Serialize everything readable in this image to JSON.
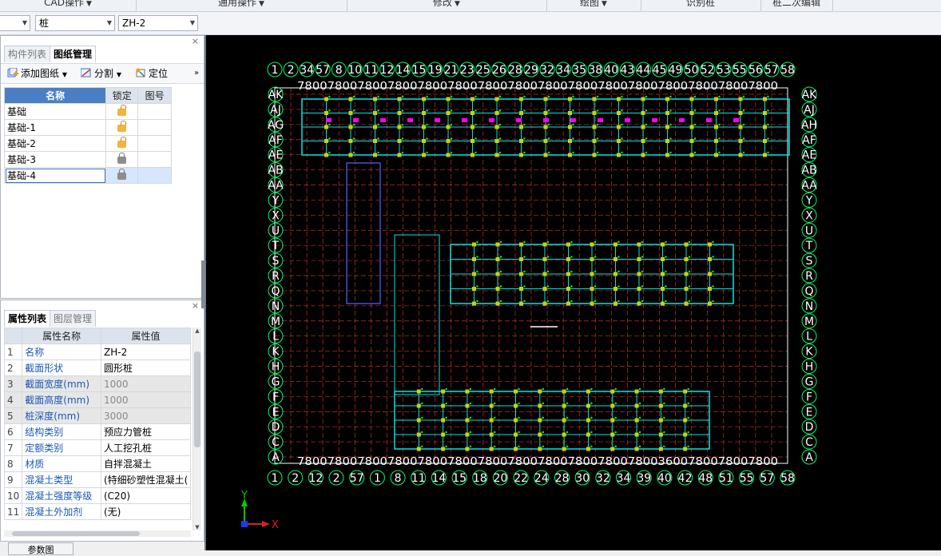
{
  "ribbon": {
    "groups": [
      {
        "label": "CAD操作",
        "arrow": true
      },
      {
        "label": "通用操作",
        "arrow": true
      },
      {
        "label": "修改",
        "arrow": true
      },
      {
        "label": "绘图",
        "arrow": true
      },
      {
        "label": "识别桩",
        "arrow": false
      },
      {
        "label": "桩二次编辑",
        "arrow": false
      }
    ]
  },
  "toolbar": {
    "combo_layer": "",
    "combo_type": "桩",
    "combo_name": "ZH-2"
  },
  "drawing_panel": {
    "tabs": [
      "构件列表",
      "图纸管理"
    ],
    "active_tab": "图纸管理",
    "buttons": {
      "add": "添加图纸",
      "split": "分割",
      "locate": "定位",
      "more": "»"
    },
    "columns": [
      "名称",
      "锁定",
      "图号"
    ],
    "rows": [
      {
        "name": "基础",
        "lock": "open",
        "no": ""
      },
      {
        "name": "基础-1",
        "lock": "open",
        "no": ""
      },
      {
        "name": "基础-2",
        "lock": "open",
        "no": ""
      },
      {
        "name": "基础-3",
        "lock": "closed",
        "no": ""
      },
      {
        "name": "基础-4",
        "lock": "closed",
        "no": ""
      }
    ],
    "close": "×"
  },
  "props_panel": {
    "tabs": [
      "属性列表",
      "图层管理"
    ],
    "active_tab": "属性列表",
    "columns": [
      "属性名称",
      "属性值"
    ],
    "rows": [
      {
        "n": "1",
        "name": "名称",
        "value": "ZH-2",
        "disabled": false
      },
      {
        "n": "2",
        "name": "截面形状",
        "value": "圆形桩",
        "disabled": false
      },
      {
        "n": "3",
        "name": "截面宽度(mm)",
        "value": "1000",
        "disabled": true
      },
      {
        "n": "4",
        "name": "截面高度(mm)",
        "value": "1000",
        "disabled": true
      },
      {
        "n": "5",
        "name": "桩深度(mm)",
        "value": "3000",
        "disabled": true
      },
      {
        "n": "6",
        "name": "结构类别",
        "value": "预应力管桩",
        "disabled": false
      },
      {
        "n": "7",
        "name": "定额类别",
        "value": "人工挖孔桩",
        "disabled": false
      },
      {
        "n": "8",
        "name": "材质",
        "value": "自拌混凝土",
        "disabled": false
      },
      {
        "n": "9",
        "name": "混凝土类型",
        "value": "(特细砂塑性混凝土(",
        "disabled": false
      },
      {
        "n": "10",
        "name": "混凝土强度等级",
        "value": "(C20)",
        "disabled": false
      },
      {
        "n": "11",
        "name": "混凝土外加剂",
        "value": "(无)",
        "disabled": false
      }
    ],
    "close": "×",
    "bottom_tab": "参数图"
  },
  "canvas": {
    "top_axis_labels": [
      "1",
      "2",
      "34",
      "57",
      "8",
      "10",
      "11",
      "12",
      "14",
      "15",
      "19",
      "21",
      "23",
      "25",
      "26",
      "28",
      "29",
      "32",
      "34",
      "35",
      "38",
      "40",
      "43",
      "44",
      "45",
      "49",
      "50",
      "52",
      "53",
      "55",
      "56",
      "57",
      "58"
    ],
    "bottom_axis_labels": [
      "1",
      "2",
      "12",
      "2",
      "57",
      "1",
      "8",
      "11",
      "14",
      "15",
      "18",
      "20",
      "22",
      "24",
      "28",
      "30",
      "32",
      "34",
      "39",
      "40",
      "42",
      "48",
      "51",
      "55",
      "57",
      "58"
    ],
    "left_axis_labels": [
      "AK",
      "AJ",
      "AG",
      "AF",
      "AE",
      "AB",
      "AA",
      "Y",
      "X",
      "U",
      "T",
      "S",
      "R",
      "Q",
      "N",
      "M",
      "L",
      "K",
      "H",
      "G",
      "F",
      "E",
      "D",
      "C",
      "A"
    ],
    "right_axis_labels": [
      "AK",
      "AJ",
      "AH",
      "AF",
      "AE",
      "AB",
      "AA",
      "Y",
      "X",
      "U",
      "T",
      "S",
      "R",
      "Q",
      "N",
      "M",
      "L",
      "K",
      "H",
      "G",
      "F",
      "E",
      "D",
      "C",
      "A"
    ],
    "dimension_text_top": "7800780078007800780078007800780078007800780078007800780078007800",
    "dimension_text_bottom": "7800780078007800780078007800780078007800780078003600780078007800",
    "ucs_x": "X",
    "ucs_y": "Y",
    "colors": {
      "background": "#000000",
      "axis_circle": "#00ff66",
      "grid_line": "#c03030",
      "beam": "#00e5e5",
      "pile": "#d0d000",
      "wall": "#ff00ff"
    }
  }
}
